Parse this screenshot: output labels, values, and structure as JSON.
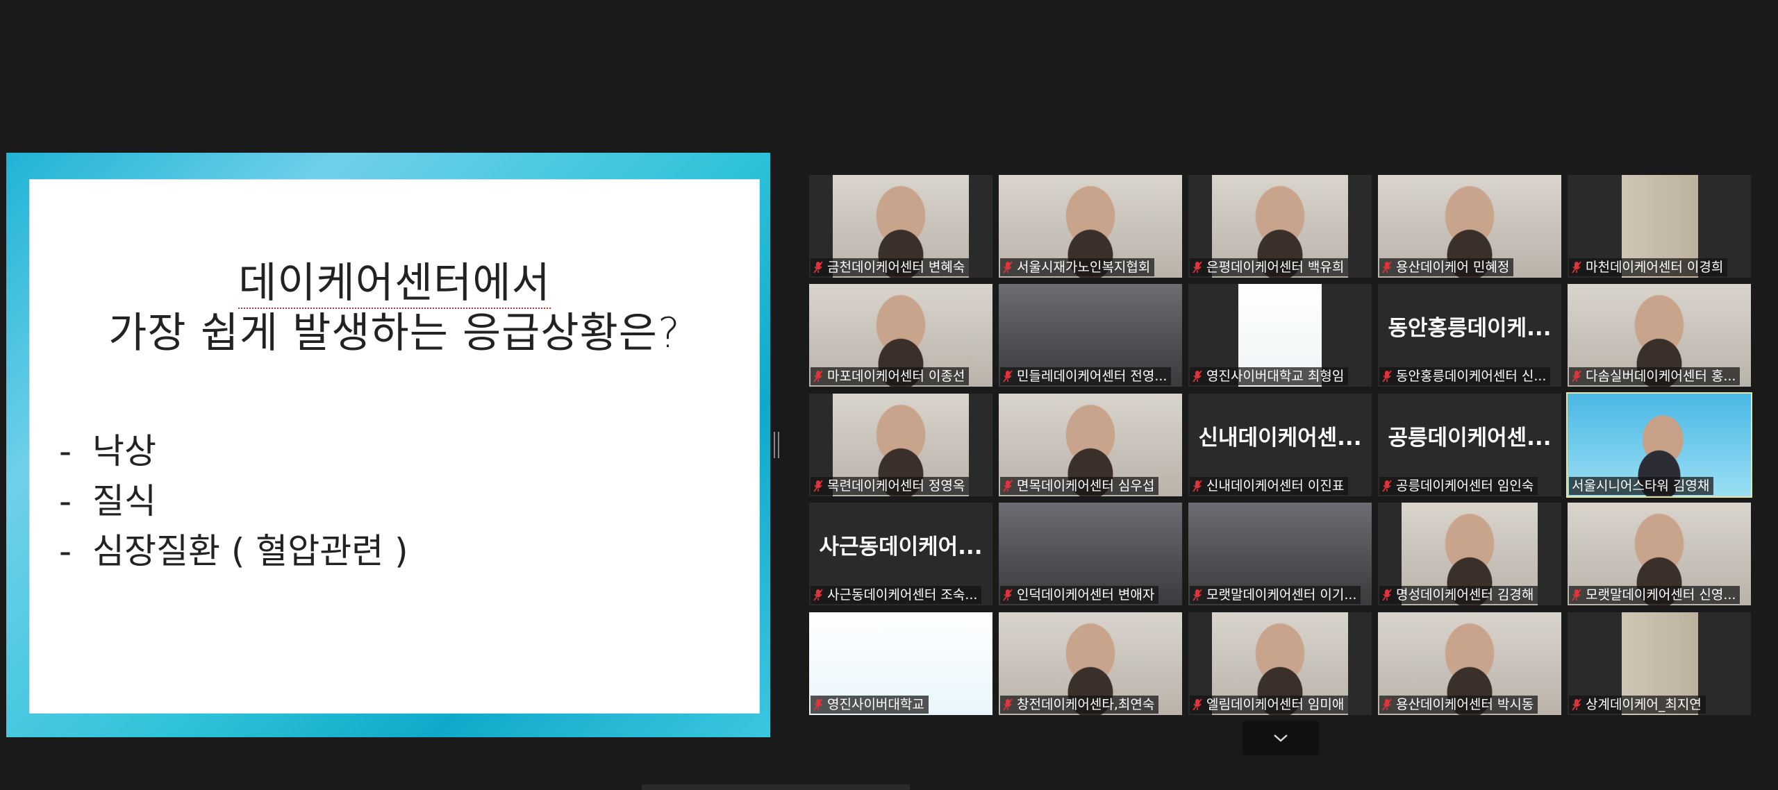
{
  "slide": {
    "title_line1": "데이케어센터에서",
    "title_line2": "가장 쉽게 발생하는 응급상황은?",
    "bullets": [
      "낙상",
      "질식",
      "심장질환 ( 혈압관련 )"
    ],
    "bullet_marker": "-"
  },
  "gallery": {
    "participants": [
      {
        "name": "금천데이케어센터 변혜숙",
        "muted": true,
        "video": "person"
      },
      {
        "name": "서울시재가노인복지협회",
        "muted": true,
        "video": "person"
      },
      {
        "name": "은평데이케어센터 백유희",
        "muted": true,
        "video": "person"
      },
      {
        "name": "용산데이케어 민혜정",
        "muted": true,
        "video": "person"
      },
      {
        "name": "마천데이케어센터 이경희",
        "muted": true,
        "video": "wall"
      },
      {
        "name": "마포데이케어센터 이종선",
        "muted": true,
        "video": "person"
      },
      {
        "name": "민들레데이케어센터 전영...",
        "muted": true,
        "video": "room"
      },
      {
        "name": "영진사이버대학교 최형임",
        "muted": true,
        "video": "screen"
      },
      {
        "name": "동안홍릉데이케어센터 신...",
        "muted": true,
        "video": "none",
        "display_name": "동안홍릉데이케..."
      },
      {
        "name": "다솜실버데이케어센터 홍...",
        "muted": true,
        "video": "person"
      },
      {
        "name": "목련데이케어센터 정영옥",
        "muted": true,
        "video": "person"
      },
      {
        "name": "면목데이케어센터 심우섭",
        "muted": true,
        "video": "person"
      },
      {
        "name": "신내데이케어센터 이진표",
        "muted": true,
        "video": "none",
        "display_name": "신내데이케어센..."
      },
      {
        "name": "공릉데이케어센터 임인숙",
        "muted": true,
        "video": "none",
        "display_name": "공릉데이케어센..."
      },
      {
        "name": "서울시니어스타워 김영채",
        "muted": false,
        "video": "banner",
        "active": true
      },
      {
        "name": "사근동데이케어센터 조숙...",
        "muted": true,
        "video": "none",
        "display_name": "사근동데이케어..."
      },
      {
        "name": "인덕데이케어센터 변애자",
        "muted": true,
        "video": "room"
      },
      {
        "name": "모랫말데이케어센터 이기...",
        "muted": true,
        "video": "room"
      },
      {
        "name": "명성데이케어센터 김경해",
        "muted": true,
        "video": "person"
      },
      {
        "name": "모랫말데이케어센터 신영...",
        "muted": true,
        "video": "person"
      },
      {
        "name": "영진사이버대학교",
        "muted": true,
        "video": "banner2"
      },
      {
        "name": "창전데이케어센타,최연숙",
        "muted": true,
        "video": "person"
      },
      {
        "name": "엘림데이케어센터 임미애",
        "muted": true,
        "video": "person"
      },
      {
        "name": "용산데이케어센터 박시동",
        "muted": true,
        "video": "person"
      },
      {
        "name": "상계데이케어_최지연",
        "muted": true,
        "video": "wall"
      }
    ],
    "next_page_icon": "chevron-down-icon"
  },
  "colors": {
    "background": "#1a1a1a",
    "active_speaker_border": "#e8e6a0",
    "muted_icon": "#e0343a"
  }
}
